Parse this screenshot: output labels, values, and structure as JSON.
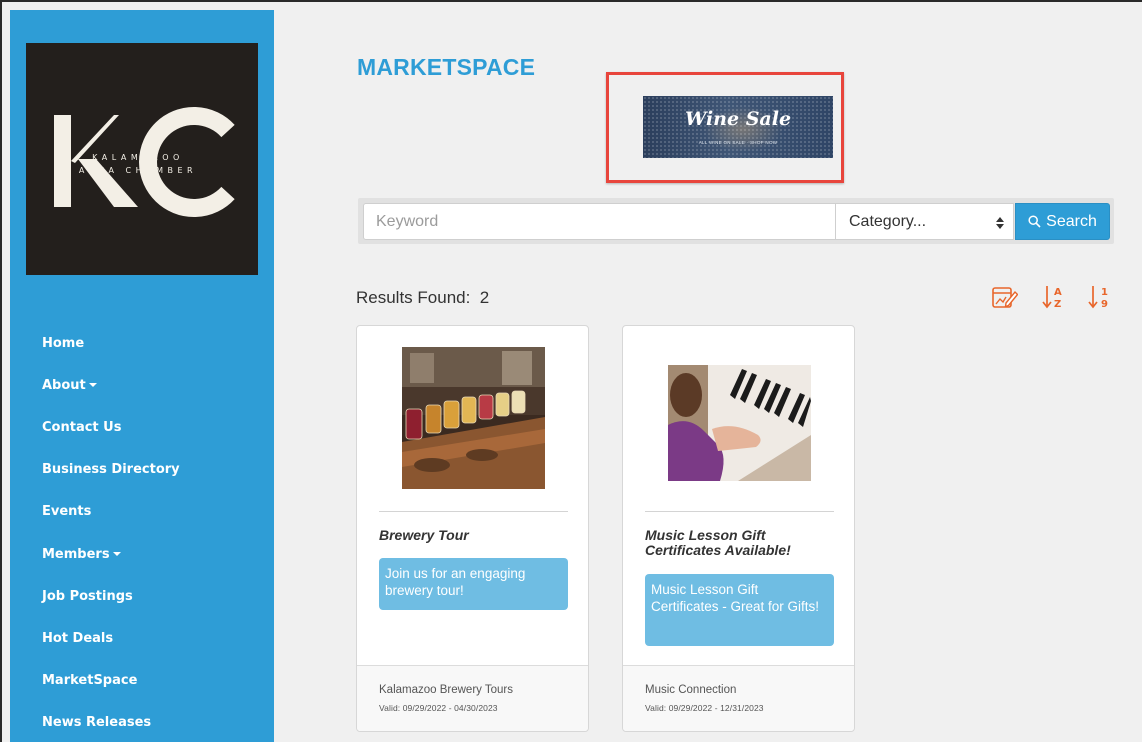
{
  "logo": {
    "monogram": "KC",
    "line1": "KALAMAZOO",
    "line2": "AREA CHAMBER"
  },
  "nav": {
    "items": [
      {
        "label": "Home"
      },
      {
        "label": "About"
      },
      {
        "label": "Contact Us"
      },
      {
        "label": "Business Directory"
      },
      {
        "label": "Events"
      },
      {
        "label": "Members"
      },
      {
        "label": "Job Postings"
      },
      {
        "label": "Hot Deals"
      },
      {
        "label": "MarketSpace"
      },
      {
        "label": "News Releases"
      }
    ]
  },
  "page": {
    "title": "MARKETSPACE"
  },
  "banner": {
    "title": "Wine Sale",
    "subtitle": "ALL WINE ON SALE · SHOP NOW"
  },
  "search": {
    "keyword_placeholder": "Keyword",
    "keyword_value": "",
    "category_selected": "Category...",
    "button_label": "Search"
  },
  "results": {
    "label": "Results Found:",
    "count": "2"
  },
  "colors": {
    "accent": "#2e9dd6",
    "sort_icons": "#e8662b",
    "highlight_box": "#e8453c",
    "description_bg": "#6fbde3"
  },
  "icons": {
    "sort_date": "calendar-edit-icon",
    "sort_alpha": "sort-a-z-icon",
    "sort_numeric": "sort-1-9-icon",
    "search": "magnifier-icon"
  },
  "cards": [
    {
      "title": "Brewery Tour",
      "description": "Join us for an engaging brewery tour!",
      "vendor": "Kalamazoo Brewery Tours",
      "valid": "Valid: 09/29/2022 - 04/30/2023"
    },
    {
      "title": "Music Lesson Gift Certificates Available!",
      "description": "Music Lesson Gift Certificates - Great for Gifts!",
      "vendor": "Music Connection",
      "valid": "Valid: 09/29/2022 - 12/31/2023"
    }
  ]
}
